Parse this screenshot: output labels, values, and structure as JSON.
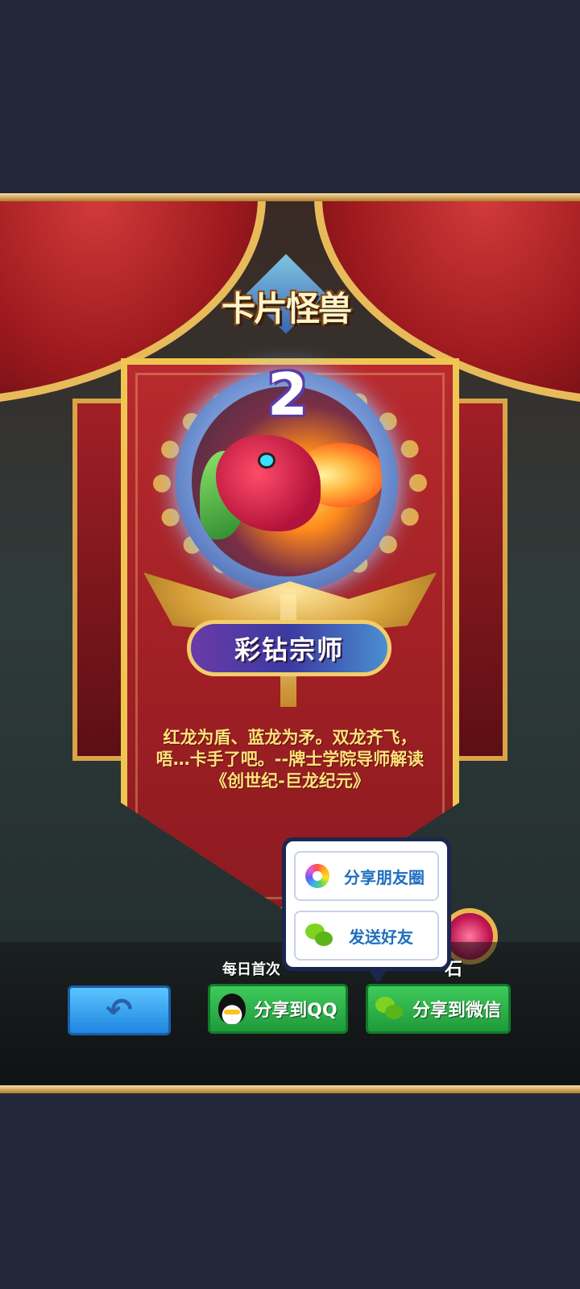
{
  "game": {
    "logo_text": "卡片怪兽",
    "rank_number": "2",
    "rank_title": "彩钻宗师",
    "description": "红龙为盾、蓝龙为矛。双龙齐飞，唔…卡手了吧。--牌士学院导师解读《创世纪-巨龙纪元》"
  },
  "share_popup": {
    "moments_label": "分享朋友圈",
    "friend_label": "发送好友"
  },
  "bottom": {
    "daily_text_visible": "每日首次",
    "reward_suffix_visible": "石",
    "back_icon": "back-arrow-icon",
    "qq_label": "分享到QQ",
    "wechat_label": "分享到微信"
  },
  "colors": {
    "background": "#232838",
    "banner_red": "#9e1f24",
    "gold": "#f0c653",
    "button_green": "#1f9a3a",
    "button_blue": "#1f86e0",
    "popup_text": "#1f6fbf"
  }
}
